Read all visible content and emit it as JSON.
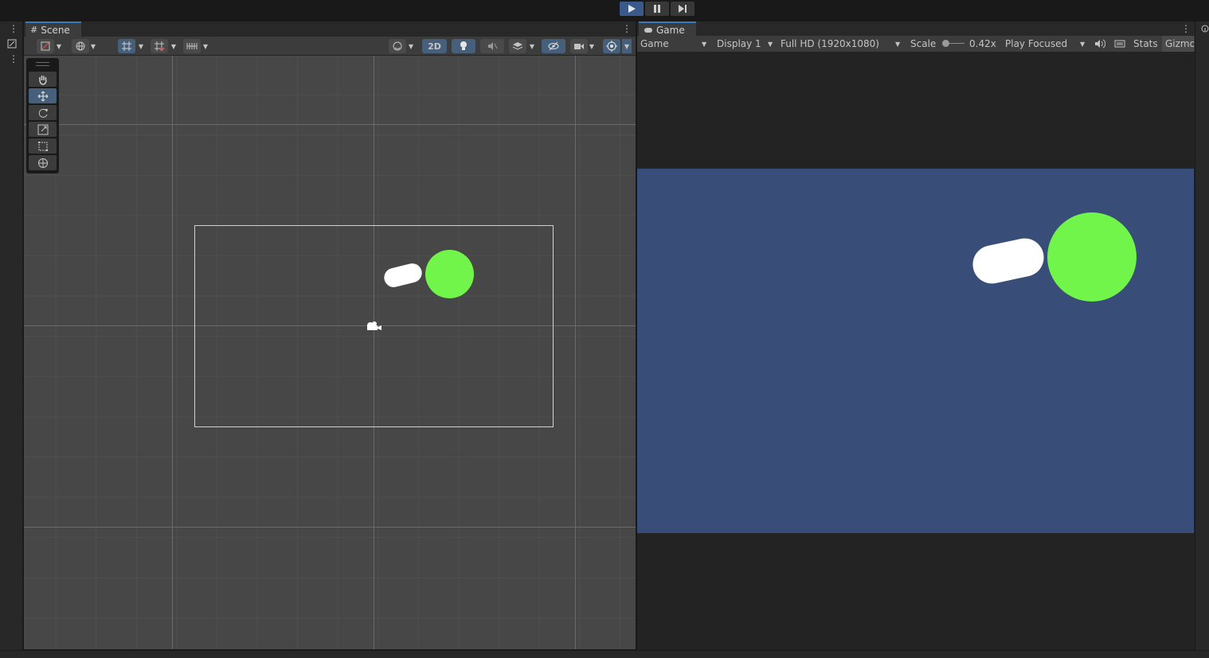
{
  "playbar": {
    "play_icon": "play-icon",
    "pause_icon": "pause-icon",
    "step_icon": "step-icon"
  },
  "scene": {
    "tab_label": "Scene",
    "toolbar": {
      "mode_2d_label": "2D"
    },
    "tools": [
      "hand-tool",
      "move-tool",
      "rotate-tool",
      "scale-tool",
      "rect-tool",
      "transform-tool"
    ],
    "selected_tool": "move-tool"
  },
  "game": {
    "tab_label": "Game",
    "view_select": "Game",
    "display_select": "Display 1",
    "resolution_select": "Full HD (1920x1080)",
    "scale_label": "Scale",
    "scale_value": "0.42x",
    "play_mode_select": "Play Focused",
    "stats_label": "Stats",
    "gizmos_label": "Gizmo",
    "background_color": "#384d77",
    "ball_color": "#72f54a",
    "paddle_color": "#ffffff"
  },
  "colors": {
    "accent": "#3a79bb",
    "selected": "#46607c"
  }
}
